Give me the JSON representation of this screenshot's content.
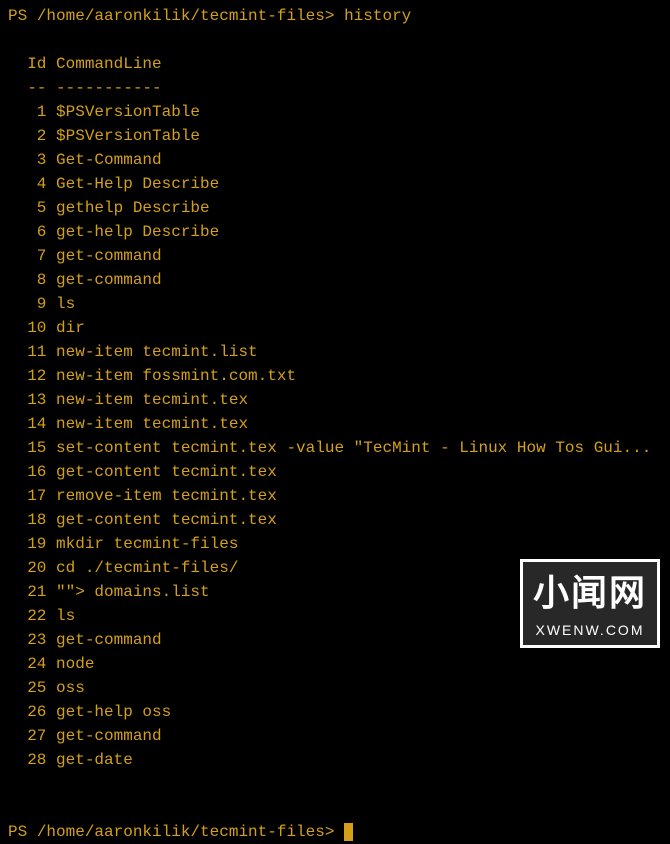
{
  "prompt1": {
    "ps": "PS ",
    "path": "/home/aaronkilik/tecmint-files",
    "arrow": "> ",
    "command": "history"
  },
  "history": {
    "header_id": "  Id",
    "header_cmd": " CommandLine",
    "sep_id": "  --",
    "sep_cmd": " -----------",
    "entries": [
      {
        "id": "   1",
        "cmd": " $PSVersionTable"
      },
      {
        "id": "   2",
        "cmd": " $PSVersionTable"
      },
      {
        "id": "   3",
        "cmd": " Get-Command"
      },
      {
        "id": "   4",
        "cmd": " Get-Help Describe"
      },
      {
        "id": "   5",
        "cmd": " gethelp Describe"
      },
      {
        "id": "   6",
        "cmd": " get-help Describe"
      },
      {
        "id": "   7",
        "cmd": " get-command"
      },
      {
        "id": "   8",
        "cmd": " get-command"
      },
      {
        "id": "   9",
        "cmd": " ls"
      },
      {
        "id": "  10",
        "cmd": " dir"
      },
      {
        "id": "  11",
        "cmd": " new-item tecmint.list"
      },
      {
        "id": "  12",
        "cmd": " new-item fossmint.com.txt"
      },
      {
        "id": "  13",
        "cmd": " new-item tecmint.tex"
      },
      {
        "id": "  14",
        "cmd": " new-item tecmint.tex"
      },
      {
        "id": "  15",
        "cmd": " set-content tecmint.tex -value \"TecMint - Linux How Tos Gui..."
      },
      {
        "id": "  16",
        "cmd": " get-content tecmint.tex"
      },
      {
        "id": "  17",
        "cmd": " remove-item tecmint.tex"
      },
      {
        "id": "  18",
        "cmd": " get-content tecmint.tex"
      },
      {
        "id": "  19",
        "cmd": " mkdir tecmint-files"
      },
      {
        "id": "  20",
        "cmd": " cd ./tecmint-files/"
      },
      {
        "id": "  21",
        "cmd": " \"\"> domains.list"
      },
      {
        "id": "  22",
        "cmd": " ls"
      },
      {
        "id": "  23",
        "cmd": " get-command"
      },
      {
        "id": "  24",
        "cmd": " node"
      },
      {
        "id": "  25",
        "cmd": " oss"
      },
      {
        "id": "  26",
        "cmd": " get-help oss"
      },
      {
        "id": "  27",
        "cmd": " get-command"
      },
      {
        "id": "  28",
        "cmd": " get-date"
      }
    ]
  },
  "prompt2": {
    "ps": "PS ",
    "path": "/home/aaronkilik/tecmint-files",
    "arrow": "> "
  },
  "watermark": {
    "main": "小闻网",
    "sub": "XWENW.COM"
  }
}
